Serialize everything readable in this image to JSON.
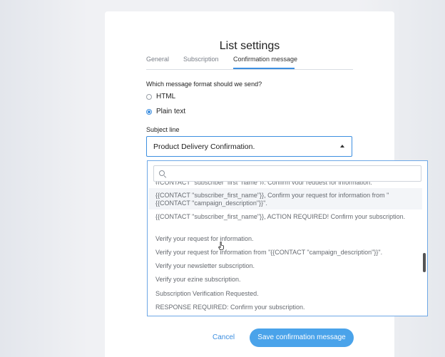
{
  "page": {
    "title": "List settings"
  },
  "tabs": [
    {
      "label": "General",
      "active": false
    },
    {
      "label": "Subscription",
      "active": false
    },
    {
      "label": "Confirmation message",
      "active": true
    }
  ],
  "message_format": {
    "question": "Which message format should we send?",
    "options": [
      {
        "label": "HTML",
        "selected": false
      },
      {
        "label": "Plain text",
        "selected": true
      }
    ]
  },
  "subject": {
    "label": "Subject line",
    "value": "Product Delivery Confirmation."
  },
  "dropdown": {
    "search_placeholder": "",
    "items": [
      "{{CONTACT \"subscriber_first_name\"}}, Confirm your request for information.",
      "{{CONTACT \"subscriber_first_name\"}}, Confirm your request for information from \"{{CONTACT \"campaign_description\"}}\".",
      "{{CONTACT \"subscriber_first_name\"}}, ACTION REQUIRED! Confirm your subscription.",
      "Verify your request for information.",
      "Verify your request for information from \"{{CONTACT \"campaign_description\"}}\".",
      "Verify your newsletter subscription.",
      "Verify your ezine subscription.",
      "Subscription Verification Requested.",
      "RESPONSE REQUIRED: Confirm your subscription."
    ]
  },
  "footer": {
    "cancel_label": "Cancel",
    "save_label": "Save confirmation message"
  },
  "colors": {
    "accent": "#3d8fe0",
    "primary_button": "#4aa3ea"
  }
}
